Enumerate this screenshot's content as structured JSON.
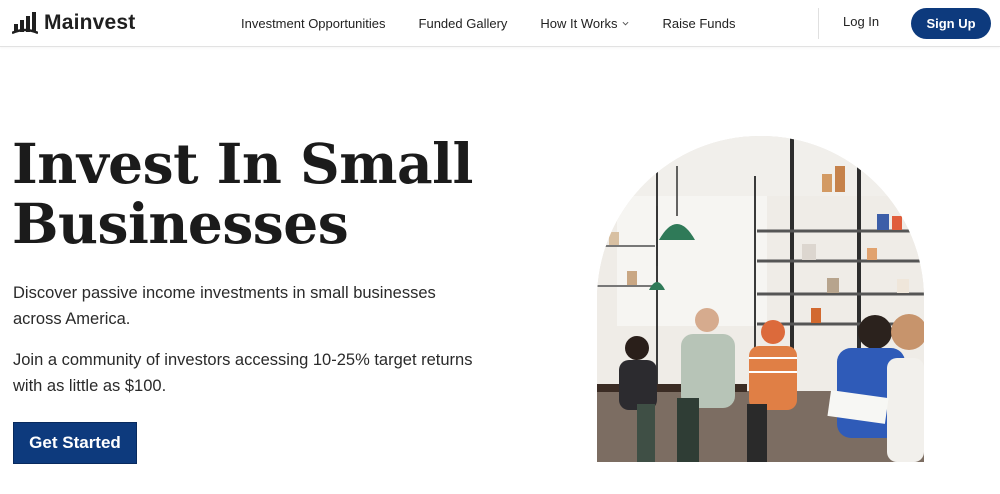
{
  "brand": {
    "name": "Mainvest",
    "accent": "#0d3a7d"
  },
  "nav": {
    "links": [
      {
        "label": "Investment Opportunities"
      },
      {
        "label": "Funded Gallery"
      },
      {
        "label": "How It Works"
      },
      {
        "label": "Raise Funds"
      }
    ],
    "login_label": "Log In",
    "signup_label": "Sign Up"
  },
  "hero": {
    "title_line1": "Invest In Small",
    "title_line2": "Businesses",
    "paragraph1": "Discover passive income investments in small businesses across America.",
    "paragraph2": "Join a community of investors accessing 10-25% target returns with as little as $100.",
    "cta_label": "Get Started"
  },
  "icons": [
    "logo-bars-icon",
    "chevron-down-icon"
  ]
}
